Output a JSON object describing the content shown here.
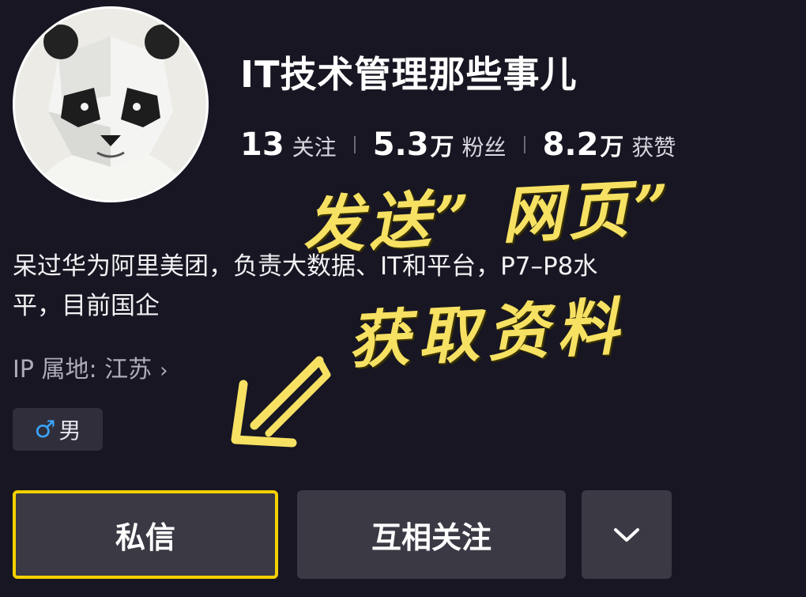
{
  "profile": {
    "name": "IT技术管理那些事儿",
    "stats": [
      {
        "num": "13",
        "unit": "",
        "label": "关注"
      },
      {
        "num": "5.3",
        "unit": "万",
        "label": "粉丝"
      },
      {
        "num": "8.2",
        "unit": "万",
        "label": "获赞"
      }
    ],
    "bio_line1": "呆过华为阿里美团，负责大数据、IT和平台，P7–P8水",
    "bio_line2": "平，目前国企",
    "ip_location": "IP 属地: 江苏",
    "ip_chevron": "›",
    "gender_symbol": "♂",
    "gender_label": "男"
  },
  "overlay": {
    "line1": "发送” 网页”",
    "line2": "获取资料",
    "color": "#f7e163"
  },
  "actions": {
    "message_label": "私信",
    "follow_label": "互相关注",
    "more_icon": "chevron-down-icon",
    "highlight_color": "#f5d000"
  }
}
